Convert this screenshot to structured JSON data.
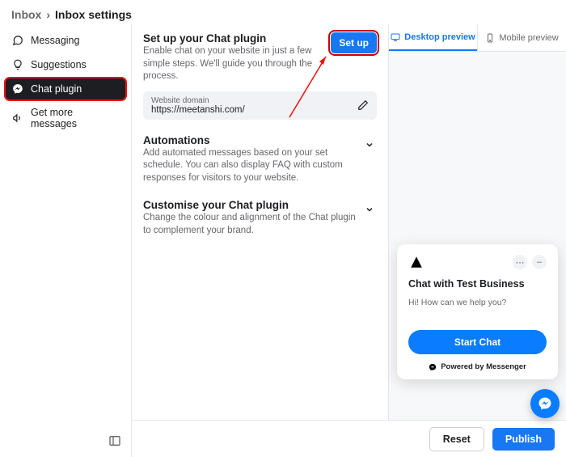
{
  "breadcrumb": {
    "root": "Inbox",
    "current": "Inbox settings"
  },
  "sidebar": {
    "items": [
      {
        "label": "Messaging"
      },
      {
        "label": "Suggestions"
      },
      {
        "label": "Chat plugin"
      },
      {
        "label": "Get more messages"
      }
    ]
  },
  "sections": {
    "setup": {
      "title": "Set up your Chat plugin",
      "desc": "Enable chat on your website in just a few simple steps. We'll guide you through the process.",
      "button": "Set up",
      "domain_label": "Website domain",
      "domain_value": "https://meetanshi.com/"
    },
    "automations": {
      "title": "Automations",
      "desc": "Add automated messages based on your set schedule. You can also display FAQ with custom responses for visitors to your website."
    },
    "customise": {
      "title": "Customise your Chat plugin",
      "desc": "Change the colour and alignment of the Chat plugin to complement your brand."
    }
  },
  "preview": {
    "tabs": {
      "desktop": "Desktop preview",
      "mobile": "Mobile preview"
    },
    "chat": {
      "title": "Chat with Test Business",
      "greeting": "Hi! How can we help you?",
      "start": "Start Chat",
      "powered": "Powered by Messenger"
    }
  },
  "footer": {
    "reset": "Reset",
    "publish": "Publish"
  }
}
